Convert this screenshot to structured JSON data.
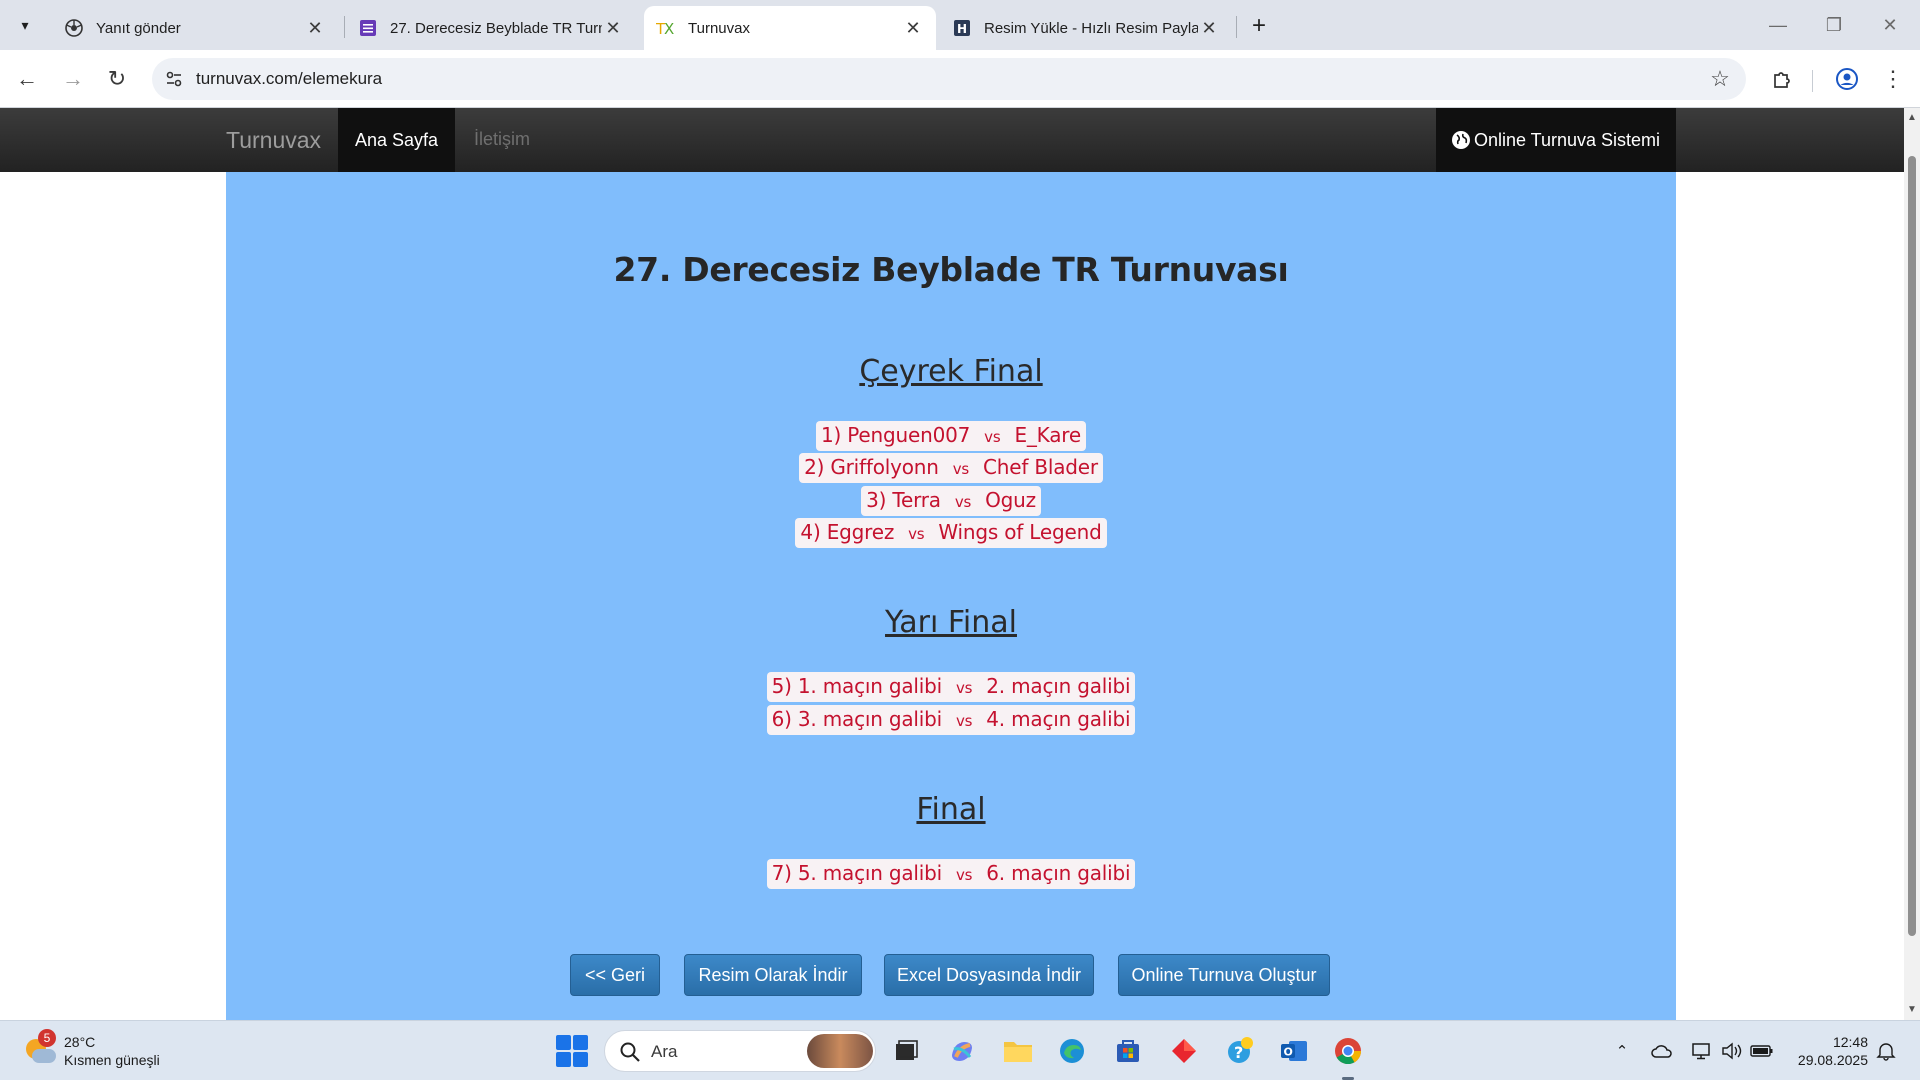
{
  "browser": {
    "tabs": [
      {
        "title": "Yanıt gönder",
        "icon": "google-forms-icon",
        "active": false
      },
      {
        "title": "27. Derecesiz Beyblade TR Turnuvası",
        "icon": "forms-list-icon",
        "active": false
      },
      {
        "title": "Turnuvax",
        "icon": "turnuvax-favicon",
        "active": true
      },
      {
        "title": "Resim Yükle - Hızlı Resim Paylaşım",
        "icon": "image-upload-favicon",
        "active": false
      }
    ],
    "url": "turnuvax.com/elemekura"
  },
  "site": {
    "brand": "Turnuvax",
    "nav_home": "Ana Sayfa",
    "nav_contact": "İletişim",
    "nav_right": "Online Turnuva Sistemi"
  },
  "tournament": {
    "title": "27. Derecesiz Beyblade TR Turnuvası",
    "vs_label": "vs",
    "rounds": [
      {
        "name": "Çeyrek Final",
        "matches": [
          {
            "left": "1) Penguen007",
            "right": "E_Kare"
          },
          {
            "left": "2) Griffolyonn",
            "right": "Chef Blader"
          },
          {
            "left": "3) Terra",
            "right": "Oguz"
          },
          {
            "left": "4) Eggrez",
            "right": "Wings of Legend"
          }
        ]
      },
      {
        "name": "Yarı Final",
        "matches": [
          {
            "left": "5) 1. maçın galibi",
            "right": "2. maçın galibi"
          },
          {
            "left": "6) 3. maçın galibi",
            "right": "4. maçın galibi"
          }
        ]
      },
      {
        "name": "Final",
        "matches": [
          {
            "left": "7) 5. maçın galibi",
            "right": "6. maçın galibi"
          }
        ]
      }
    ]
  },
  "actions": {
    "back": "<< Geri",
    "download_image": "Resim Olarak İndir",
    "download_excel": "Excel Dosyasında İndir",
    "create_online": "Online Turnuva Oluştur"
  },
  "taskbar": {
    "weather_badge": "5",
    "temperature": "28°C",
    "weather_desc": "Kısmen güneşli",
    "search_placeholder": "Ara",
    "time": "12:48",
    "date": "29.08.2025"
  },
  "colors": {
    "panel_bg": "#80bdfc",
    "match_text": "#c4122f",
    "button_blue": "#2a6ea8",
    "nav_dark": "#222222"
  }
}
